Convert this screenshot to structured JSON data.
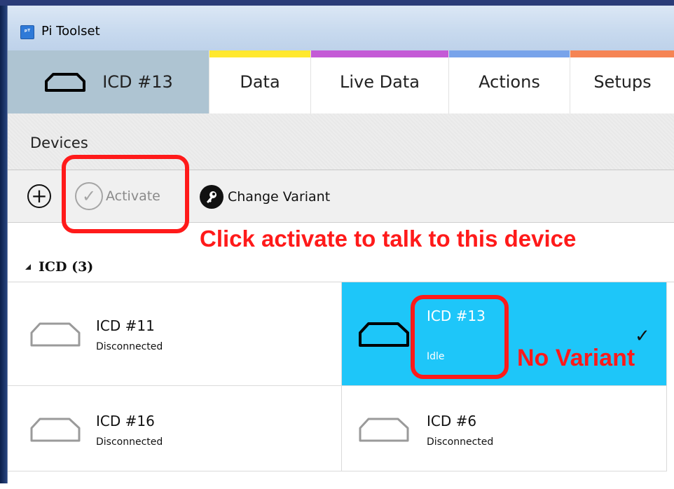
{
  "window": {
    "title": "Pi Toolset",
    "app_icon_text": "ᵖᵀ"
  },
  "tabs": {
    "device_tab_label": "ICD #13",
    "data_label": "Data",
    "live_label": "Live Data",
    "actions_label": "Actions",
    "setups_label": "Setups",
    "colors": {
      "data": "#ffe82e",
      "live": "#c45ad6",
      "actions": "#78a3ea",
      "setups": "#f58454"
    }
  },
  "devices_panel": {
    "title": "Devices",
    "toolbar": {
      "add_icon": "plus-circle-icon",
      "activate_label": "Activate",
      "change_variant_label": "Change Variant"
    },
    "group": {
      "label": "ICD (3)"
    },
    "devices": [
      {
        "name": "ICD #11",
        "status": "Disconnected",
        "selected": false
      },
      {
        "name": "ICD #13",
        "status": "Idle",
        "selected": true
      },
      {
        "name": "ICD #16",
        "status": "Disconnected",
        "selected": false
      },
      {
        "name": "ICD #6",
        "status": "Disconnected",
        "selected": false
      }
    ]
  },
  "annotations": {
    "activate_hint": "Click activate to talk to this device",
    "variant_hint": "No Variant",
    "color": "#ff1a1a"
  }
}
